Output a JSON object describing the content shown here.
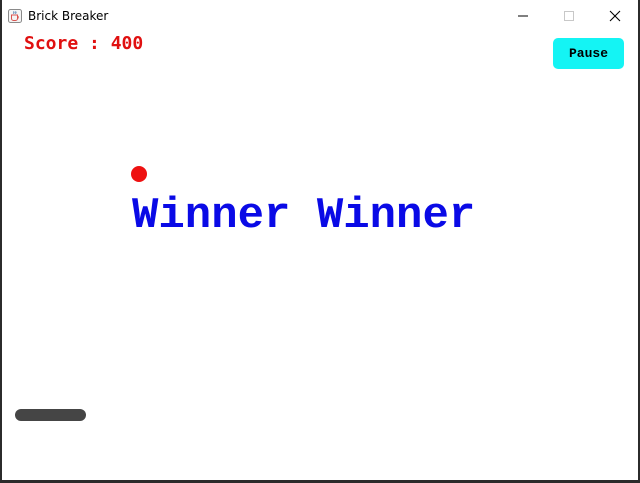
{
  "window": {
    "title": "Brick Breaker",
    "icon": "java-cup-icon",
    "controls": [
      "minimize-icon",
      "maximize-icon",
      "close-icon"
    ]
  },
  "game": {
    "score_text": "Score : 400",
    "pause_label": "Pause",
    "message": "Winner Winner"
  },
  "colors": {
    "score": "#e01010",
    "pause_button_bg": "#14f4f4",
    "ball": "#ee1111",
    "message": "#0a0ae6",
    "paddle": "#454545",
    "border": "#2b2b2b"
  }
}
